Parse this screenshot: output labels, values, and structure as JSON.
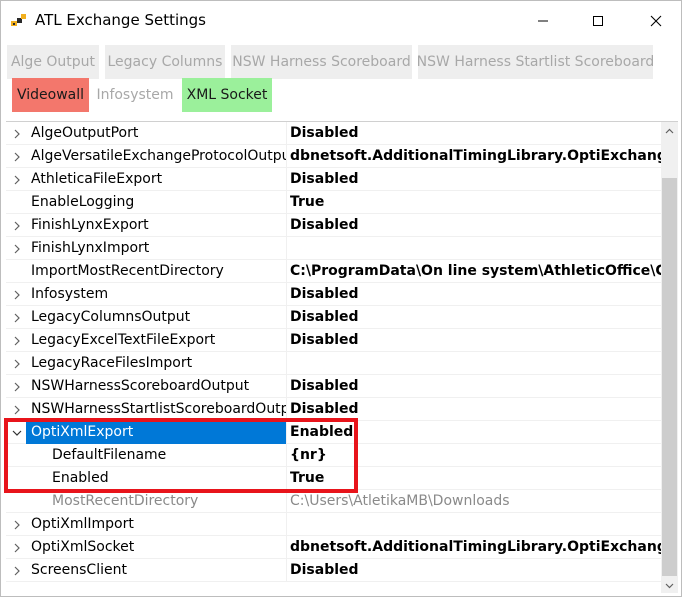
{
  "window": {
    "title": "ATL Exchange Settings",
    "icon": "wrench-app-icon"
  },
  "buttons": [
    {
      "label": "Alge Output",
      "state": "disabled"
    },
    {
      "label": "Legacy Columns",
      "state": "disabled"
    },
    {
      "label": "NSW Harness Scoreboard",
      "state": "disabled"
    },
    {
      "label": "NSW Harness Startlist Scoreboard",
      "state": "disabled"
    },
    {
      "label": "Videowall",
      "state": "active-red",
      "color": "#f3776c"
    },
    {
      "label": "Infosystem",
      "state": "disabled"
    },
    {
      "label": "XML Socket",
      "state": "active-green",
      "color": "#9bf09b"
    }
  ],
  "properties": [
    {
      "name": "AlgeOutputPort",
      "value": "Disabled",
      "expandable": true
    },
    {
      "name": "AlgeVersatileExchangeProtocolOutput",
      "value": "dbnetsoft.AdditionalTimingLibrary.OptiExchange.Alge",
      "expandable": true
    },
    {
      "name": "AthleticaFileExport",
      "value": "Disabled",
      "expandable": true
    },
    {
      "name": "EnableLogging",
      "value": "True",
      "expandable": false
    },
    {
      "name": "FinishLynxExport",
      "value": "Disabled",
      "expandable": true
    },
    {
      "name": "FinishLynxImport",
      "value": "",
      "expandable": true
    },
    {
      "name": "ImportMostRecentDirectory",
      "value": "C:\\ProgramData\\On line system\\AthleticOffice\\Camer",
      "expandable": false
    },
    {
      "name": "Infosystem",
      "value": "Disabled",
      "expandable": true
    },
    {
      "name": "LegacyColumnsOutput",
      "value": "Disabled",
      "expandable": true
    },
    {
      "name": "LegacyExcelTextFileExport",
      "value": "Disabled",
      "expandable": true
    },
    {
      "name": "LegacyRaceFilesImport",
      "value": "",
      "expandable": true
    },
    {
      "name": "NSWHarnessScoreboardOutput",
      "value": "Disabled",
      "expandable": true
    },
    {
      "name": "NSWHarnessStartlistScoreboardOutput",
      "value": "Disabled",
      "expandable": true
    },
    {
      "name": "OptiXmlExport",
      "value": "Enabled",
      "expandable": true,
      "expanded": true,
      "selected": true
    },
    {
      "name": "DefaultFilename",
      "value": "{nr}",
      "level": 1
    },
    {
      "name": "Enabled",
      "value": "True",
      "level": 1
    },
    {
      "name": "MostRecentDirectory",
      "value": "C:\\Users\\AtletikaMB\\Downloads",
      "level": 1,
      "dim": true
    },
    {
      "name": "OptiXmlImport",
      "value": "",
      "expandable": true
    },
    {
      "name": "OptiXmlSocket",
      "value": "dbnetsoft.AdditionalTimingLibrary.OptiExchange.Opti",
      "expandable": true
    },
    {
      "name": "ScreensClient",
      "value": "Disabled",
      "expandable": true
    }
  ],
  "colors": {
    "selection": "#0078d7",
    "highlight_box": "#e8141b"
  }
}
